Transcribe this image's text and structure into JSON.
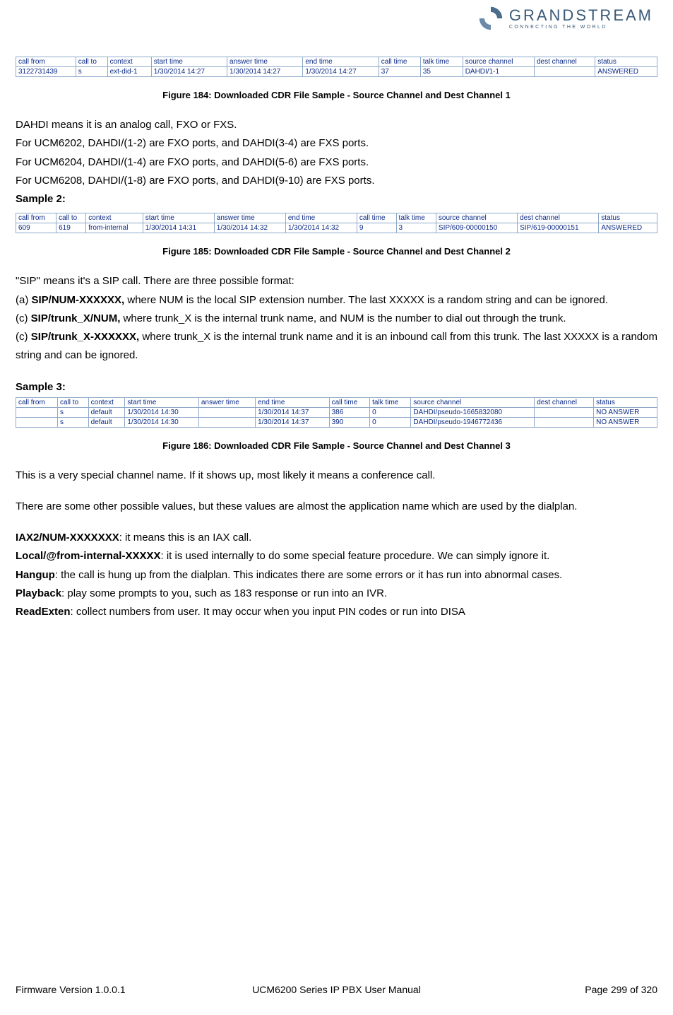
{
  "logo": {
    "main": "GRANDSTREAM",
    "sub": "CONNECTING THE WORLD"
  },
  "table1": {
    "headers": [
      "call from",
      "call to",
      "context",
      "start time",
      "answer time",
      "end time",
      "call time",
      "talk time",
      "source channel",
      "dest channel",
      "status"
    ],
    "rows": [
      [
        "3122731439",
        "s",
        "ext-did-1",
        "1/30/2014 14:27",
        "1/30/2014 14:27",
        "1/30/2014 14:27",
        "37",
        "35",
        "DAHDI/1-1",
        "",
        "ANSWERED"
      ]
    ]
  },
  "caption1": "Figure 184: Downloaded CDR File Sample - Source Channel and Dest Channel 1",
  "para1_l1": "DAHDI means it is an analog call, FXO or FXS.",
  "para1_l2": "For UCM6202, DAHDI/(1-2) are FXO ports, and DAHDI(3-4) are FXS ports.",
  "para1_l3": "For UCM6204, DAHDI/(1-4) are FXO ports, and DAHDI(5-6) are FXS ports.",
  "para1_l4": "For UCM6208, DAHDI/(1-8) are FXO ports, and DAHDI(9-10) are FXS ports.",
  "sample2_label": "Sample 2:",
  "table2": {
    "headers": [
      "call from",
      "call to",
      "context",
      "start time",
      "answer time",
      "end time",
      "call time",
      "talk time",
      "source channel",
      "dest channel",
      "status"
    ],
    "rows": [
      [
        "609",
        "619",
        "from-internal",
        "1/30/2014 14:31",
        "1/30/2014 14:32",
        "1/30/2014 14:32",
        "9",
        "3",
        "SIP/609-00000150",
        "SIP/619-00000151",
        "ANSWERED"
      ]
    ]
  },
  "caption2": "Figure 185: Downloaded CDR File Sample - Source Channel and Dest Channel 2",
  "sip_intro": "\"SIP\" means it's a SIP call. There are three possible format:",
  "sip_a_prefix": "(a) ",
  "sip_a_bold": "SIP/NUM-XXXXXX,",
  "sip_a_rest": " where NUM is the local SIP extension number. The last XXXXX is a random string and can be ignored.",
  "sip_c1_prefix": "(c) ",
  "sip_c1_bold": "SIP/trunk_X/NUM,",
  "sip_c1_rest": " where trunk_X is the internal trunk name, and NUM is the number to dial out through the trunk.",
  "sip_c2_prefix": "(c) ",
  "sip_c2_bold": "SIP/trunk_X-XXXXXX,",
  "sip_c2_rest": " where trunk_X is the internal trunk name and it is an inbound call from this trunk. The last XXXXX is a random string and can be ignored.",
  "sample3_label": "Sample 3:",
  "table3": {
    "headers": [
      "call from",
      "call to",
      "context",
      "start time",
      "answer time",
      "end time",
      "call time",
      "talk time",
      "source channel",
      "dest channel",
      "status"
    ],
    "rows": [
      [
        "",
        "s",
        "default",
        "1/30/2014 14:30",
        "",
        "1/30/2014 14:37",
        "386",
        "0",
        "DAHDI/pseudo-1665832080",
        "",
        "NO ANSWER"
      ],
      [
        "",
        "s",
        "default",
        "1/30/2014 14:30",
        "",
        "1/30/2014 14:37",
        "390",
        "0",
        "DAHDI/pseudo-1946772436",
        "",
        "NO ANSWER"
      ]
    ]
  },
  "caption3": "Figure 186: Downloaded CDR File Sample - Source Channel and Dest Channel 3",
  "conf_line": "This is a very special channel name. If it shows up, most likely it means a conference call.",
  "other_values": "There are some other possible values, but these values are almost the application name which are used by the dialplan.",
  "iax_bold": "IAX2/NUM-XXXXXXX",
  "iax_rest": ": it means this is an IAX call.",
  "local_bold": "Local/@from-internal-XXXXX",
  "local_rest": ": it is used internally to do some special feature procedure. We can simply ignore it.",
  "hangup_bold": "Hangup",
  "hangup_rest": ": the call is hung up from the dialplan. This indicates there are some errors or it has run into abnormal cases.",
  "playback_bold": "Playback",
  "playback_rest": ": play some prompts to you, such as 183 response or run into an IVR.",
  "readexten_bold": "ReadExten",
  "readexten_rest": ": collect numbers from user. It may occur when you input PIN codes or run into DISA",
  "footer": {
    "left": "Firmware Version 1.0.0.1",
    "center": "UCM6200 Series IP PBX User Manual",
    "right": "Page 299 of 320"
  }
}
